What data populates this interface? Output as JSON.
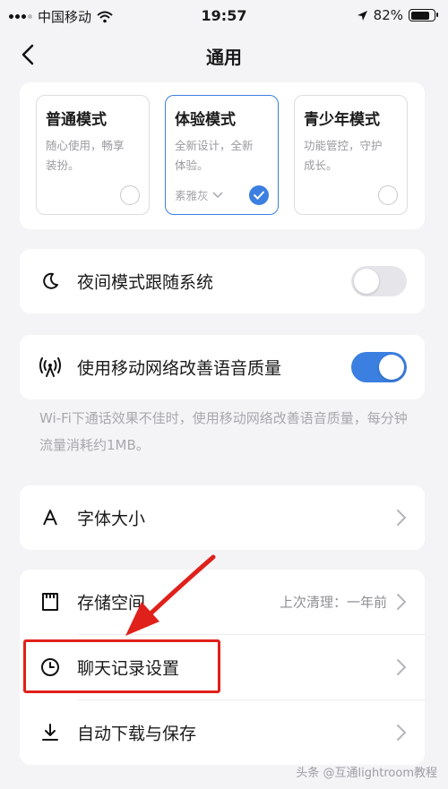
{
  "status_bar": {
    "carrier": "中国移动",
    "time": "19:57",
    "battery": "82%",
    "battery_level": 0.82
  },
  "nav": {
    "title": "通用",
    "back_icon": "chevron-left-icon"
  },
  "modes": [
    {
      "title": "普通模式",
      "desc_line1": "随心使用，畅享",
      "desc_line2": "装扮。",
      "selected": false
    },
    {
      "title": "体验模式",
      "desc_line1": "全新设计，全新",
      "desc_line2": "体验。",
      "theme": "素雅灰",
      "selected": true
    },
    {
      "title": "青少年模式",
      "desc_line1": "功能管控，守护",
      "desc_line2": "成长。",
      "selected": false
    }
  ],
  "settings": {
    "night_mode": {
      "label": "夜间模式跟随系统",
      "enabled": false
    },
    "mobile_voice": {
      "label": "使用移动网络改善语音质量",
      "enabled": true
    },
    "mobile_voice_hint": "Wi-Fi下通话效果不佳时，使用移动网络改善语音质量，每分钟流量消耗约1MB。",
    "font_size": {
      "label": "字体大小"
    },
    "storage": {
      "label": "存储空间",
      "value": "上次清理：一年前"
    },
    "chat_history": {
      "label": "聊天记录设置"
    },
    "auto_download": {
      "label": "自动下载与保存"
    }
  },
  "watermark": "头条 @互通lightroom教程",
  "colors": {
    "accent": "#3b7fe0",
    "annotation": "#e0201b"
  }
}
